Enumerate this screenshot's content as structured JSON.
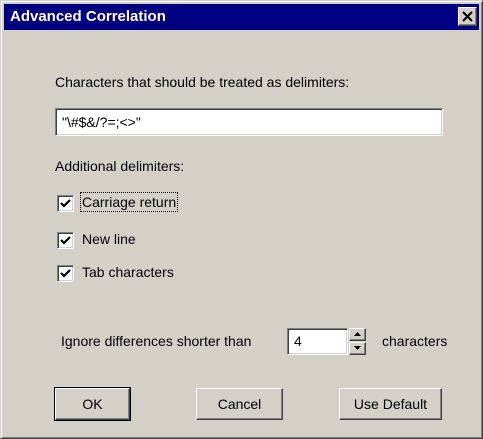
{
  "window": {
    "title": "Advanced Correlation",
    "close_glyph": "close-icon"
  },
  "delimiters": {
    "label": "Characters that should be treated as delimiters:",
    "value": "\"\\#$&/?=;<>\""
  },
  "additional": {
    "label": "Additional delimiters:",
    "options": [
      {
        "label": "Carriage return",
        "checked": true
      },
      {
        "label": "New line",
        "checked": true
      },
      {
        "label": "Tab characters",
        "checked": true
      }
    ]
  },
  "ignore": {
    "prefix": "Ignore differences shorter than",
    "value": "4",
    "suffix": "characters"
  },
  "buttons": {
    "ok": "OK",
    "cancel": "Cancel",
    "use_default": "Use Default"
  },
  "colors": {
    "titlebar": "#000080",
    "face": "#d4d0c8"
  }
}
